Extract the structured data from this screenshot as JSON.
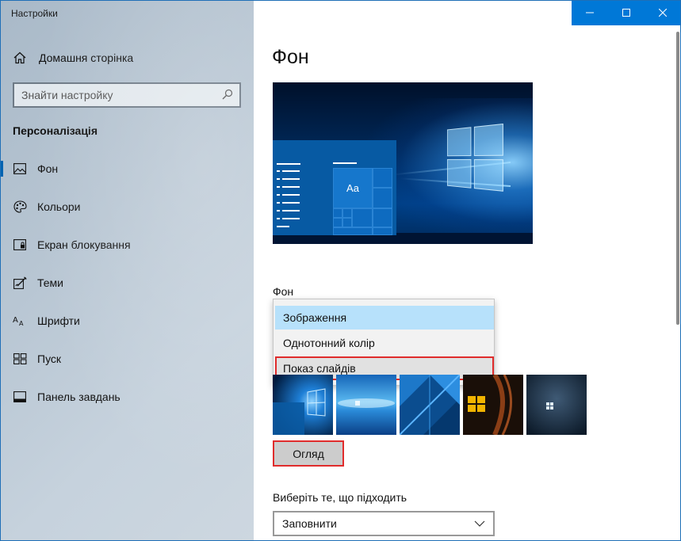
{
  "window": {
    "title": "Настройки"
  },
  "sidebar": {
    "home_label": "Домашня сторінка",
    "search_placeholder": "Знайти настройку",
    "section_title": "Персоналізація",
    "items": [
      {
        "label": "Фон",
        "icon": "picture-icon",
        "active": true
      },
      {
        "label": "Кольори",
        "icon": "palette-icon",
        "active": false
      },
      {
        "label": "Екран блокування",
        "icon": "lock-screen-icon",
        "active": false
      },
      {
        "label": "Теми",
        "icon": "themes-icon",
        "active": false
      },
      {
        "label": "Шрифти",
        "icon": "fonts-icon",
        "active": false
      },
      {
        "label": "Пуск",
        "icon": "start-icon",
        "active": false
      },
      {
        "label": "Панель завдань",
        "icon": "taskbar-icon",
        "active": false
      }
    ]
  },
  "main": {
    "page_title": "Фон",
    "preview": {
      "sample_text": "Aa"
    },
    "background_label": "Фон",
    "background_options": [
      {
        "label": "Зображення",
        "state": "selected"
      },
      {
        "label": "Однотонний колір",
        "state": "normal"
      },
      {
        "label": "Показ слайдів",
        "state": "highlighted"
      }
    ],
    "browse_button": "Огляд",
    "fit_label": "Виберіть те, що підходить",
    "fit_value": "Заповнити"
  },
  "colors": {
    "accent": "#0078d7",
    "highlight_outline": "#e02c2c",
    "selected_option": "#b7e1fb"
  }
}
